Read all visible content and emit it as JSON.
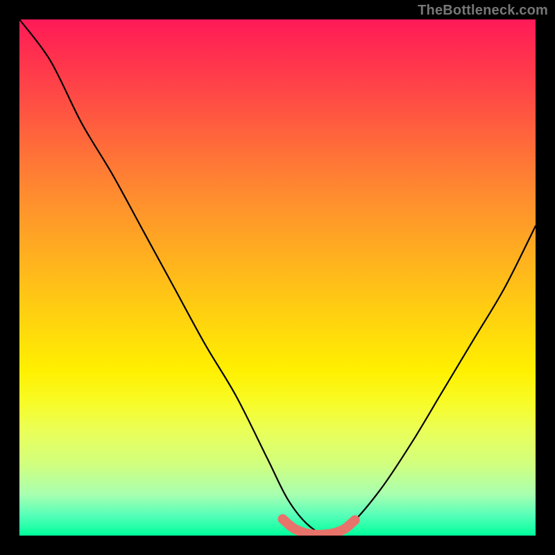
{
  "watermark": "TheBottleneck.com",
  "chart_data": {
    "type": "line",
    "title": "",
    "xlabel": "",
    "ylabel": "",
    "xlim": [
      0,
      100
    ],
    "ylim": [
      0,
      100
    ],
    "grid": false,
    "series": [
      {
        "name": "bottleneck-curve",
        "color": "#000000",
        "x": [
          0,
          6,
          12,
          18,
          24,
          30,
          36,
          42,
          48,
          52,
          56,
          60,
          64,
          70,
          76,
          82,
          88,
          94,
          100
        ],
        "y": [
          100,
          92,
          80,
          70,
          59,
          48,
          37,
          27,
          15,
          7,
          2,
          0,
          2,
          9,
          18,
          28,
          38,
          48,
          60
        ]
      },
      {
        "name": "accent-segment",
        "color": "#e8736a",
        "x": [
          51,
          53,
          55,
          57,
          59,
          61,
          63,
          65
        ],
        "y": [
          3.2,
          1.5,
          0.6,
          0.2,
          0.2,
          0.5,
          1.3,
          3.0
        ]
      }
    ],
    "annotations": []
  }
}
